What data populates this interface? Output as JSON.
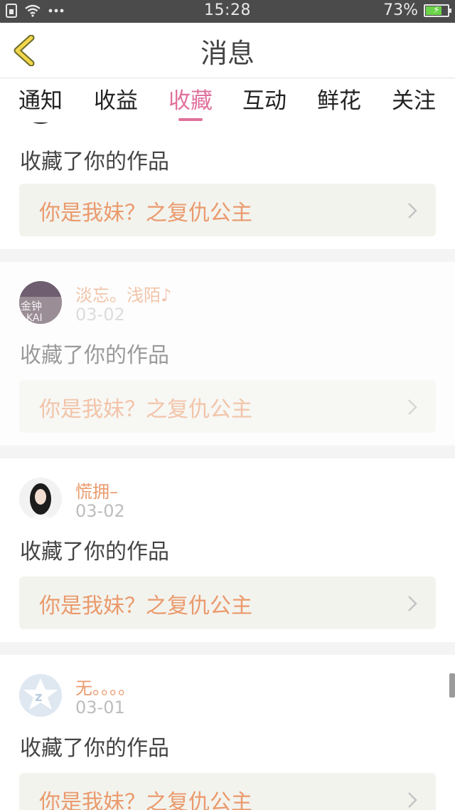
{
  "status_bar": {
    "time": "15:28",
    "battery_percent": "73%",
    "battery_level": 0.73,
    "icons": [
      "sim-icon",
      "wifi-icon",
      "more-dots-icon",
      "battery-icon"
    ]
  },
  "header": {
    "title": "消息",
    "back_icon": "chevron-left-icon"
  },
  "tabs": [
    {
      "label": "通知",
      "active": false
    },
    {
      "label": "收益",
      "active": false
    },
    {
      "label": "收藏",
      "active": true
    },
    {
      "label": "互动",
      "active": false
    },
    {
      "label": "鲜花",
      "active": false
    },
    {
      "label": "关注",
      "active": false
    }
  ],
  "colors": {
    "accent": "#e0719c",
    "username": "#ea9a6c",
    "status_bar_bg": "#4b4b4b"
  },
  "feed": [
    {
      "user": "",
      "date": "",
      "action": "收藏了你的作品",
      "work_title": "你是我妹？之复仇公主"
    },
    {
      "user": "淡忘。浅陌♪",
      "date": "03-02",
      "action": "收藏了你的作品",
      "work_title": "你是我妹？之复仇公主",
      "avatar_text": [
        "金钟",
        "KAI"
      ]
    },
    {
      "user": "慌拥–",
      "date": "03-02",
      "action": "收藏了你的作品",
      "work_title": "你是我妹？之复仇公主"
    },
    {
      "user": "无。。。。",
      "date": "03-01",
      "action": "收藏了你的作品",
      "work_title": "你是我妹？之复仇公主"
    }
  ]
}
